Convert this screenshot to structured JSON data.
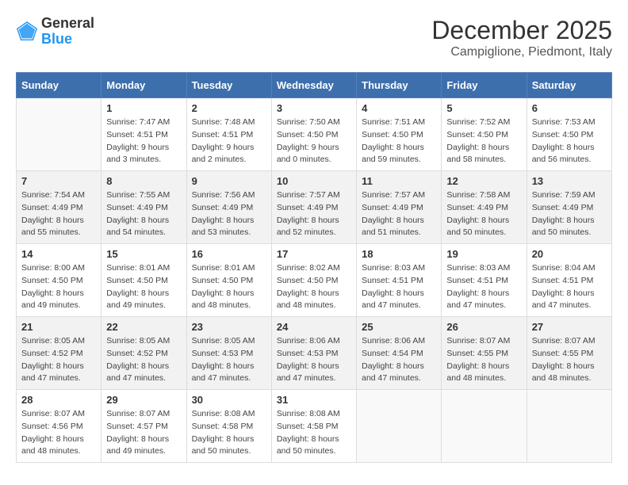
{
  "logo": {
    "general": "General",
    "blue": "Blue"
  },
  "title": "December 2025",
  "subtitle": "Campiglione, Piedmont, Italy",
  "days_of_week": [
    "Sunday",
    "Monday",
    "Tuesday",
    "Wednesday",
    "Thursday",
    "Friday",
    "Saturday"
  ],
  "weeks": [
    {
      "shaded": false,
      "days": [
        {
          "num": "",
          "sunrise": "",
          "sunset": "",
          "daylight": ""
        },
        {
          "num": "1",
          "sunrise": "Sunrise: 7:47 AM",
          "sunset": "Sunset: 4:51 PM",
          "daylight": "Daylight: 9 hours and 3 minutes."
        },
        {
          "num": "2",
          "sunrise": "Sunrise: 7:48 AM",
          "sunset": "Sunset: 4:51 PM",
          "daylight": "Daylight: 9 hours and 2 minutes."
        },
        {
          "num": "3",
          "sunrise": "Sunrise: 7:50 AM",
          "sunset": "Sunset: 4:50 PM",
          "daylight": "Daylight: 9 hours and 0 minutes."
        },
        {
          "num": "4",
          "sunrise": "Sunrise: 7:51 AM",
          "sunset": "Sunset: 4:50 PM",
          "daylight": "Daylight: 8 hours and 59 minutes."
        },
        {
          "num": "5",
          "sunrise": "Sunrise: 7:52 AM",
          "sunset": "Sunset: 4:50 PM",
          "daylight": "Daylight: 8 hours and 58 minutes."
        },
        {
          "num": "6",
          "sunrise": "Sunrise: 7:53 AM",
          "sunset": "Sunset: 4:50 PM",
          "daylight": "Daylight: 8 hours and 56 minutes."
        }
      ]
    },
    {
      "shaded": true,
      "days": [
        {
          "num": "7",
          "sunrise": "Sunrise: 7:54 AM",
          "sunset": "Sunset: 4:49 PM",
          "daylight": "Daylight: 8 hours and 55 minutes."
        },
        {
          "num": "8",
          "sunrise": "Sunrise: 7:55 AM",
          "sunset": "Sunset: 4:49 PM",
          "daylight": "Daylight: 8 hours and 54 minutes."
        },
        {
          "num": "9",
          "sunrise": "Sunrise: 7:56 AM",
          "sunset": "Sunset: 4:49 PM",
          "daylight": "Daylight: 8 hours and 53 minutes."
        },
        {
          "num": "10",
          "sunrise": "Sunrise: 7:57 AM",
          "sunset": "Sunset: 4:49 PM",
          "daylight": "Daylight: 8 hours and 52 minutes."
        },
        {
          "num": "11",
          "sunrise": "Sunrise: 7:57 AM",
          "sunset": "Sunset: 4:49 PM",
          "daylight": "Daylight: 8 hours and 51 minutes."
        },
        {
          "num": "12",
          "sunrise": "Sunrise: 7:58 AM",
          "sunset": "Sunset: 4:49 PM",
          "daylight": "Daylight: 8 hours and 50 minutes."
        },
        {
          "num": "13",
          "sunrise": "Sunrise: 7:59 AM",
          "sunset": "Sunset: 4:49 PM",
          "daylight": "Daylight: 8 hours and 50 minutes."
        }
      ]
    },
    {
      "shaded": false,
      "days": [
        {
          "num": "14",
          "sunrise": "Sunrise: 8:00 AM",
          "sunset": "Sunset: 4:50 PM",
          "daylight": "Daylight: 8 hours and 49 minutes."
        },
        {
          "num": "15",
          "sunrise": "Sunrise: 8:01 AM",
          "sunset": "Sunset: 4:50 PM",
          "daylight": "Daylight: 8 hours and 49 minutes."
        },
        {
          "num": "16",
          "sunrise": "Sunrise: 8:01 AM",
          "sunset": "Sunset: 4:50 PM",
          "daylight": "Daylight: 8 hours and 48 minutes."
        },
        {
          "num": "17",
          "sunrise": "Sunrise: 8:02 AM",
          "sunset": "Sunset: 4:50 PM",
          "daylight": "Daylight: 8 hours and 48 minutes."
        },
        {
          "num": "18",
          "sunrise": "Sunrise: 8:03 AM",
          "sunset": "Sunset: 4:51 PM",
          "daylight": "Daylight: 8 hours and 47 minutes."
        },
        {
          "num": "19",
          "sunrise": "Sunrise: 8:03 AM",
          "sunset": "Sunset: 4:51 PM",
          "daylight": "Daylight: 8 hours and 47 minutes."
        },
        {
          "num": "20",
          "sunrise": "Sunrise: 8:04 AM",
          "sunset": "Sunset: 4:51 PM",
          "daylight": "Daylight: 8 hours and 47 minutes."
        }
      ]
    },
    {
      "shaded": true,
      "days": [
        {
          "num": "21",
          "sunrise": "Sunrise: 8:05 AM",
          "sunset": "Sunset: 4:52 PM",
          "daylight": "Daylight: 8 hours and 47 minutes."
        },
        {
          "num": "22",
          "sunrise": "Sunrise: 8:05 AM",
          "sunset": "Sunset: 4:52 PM",
          "daylight": "Daylight: 8 hours and 47 minutes."
        },
        {
          "num": "23",
          "sunrise": "Sunrise: 8:05 AM",
          "sunset": "Sunset: 4:53 PM",
          "daylight": "Daylight: 8 hours and 47 minutes."
        },
        {
          "num": "24",
          "sunrise": "Sunrise: 8:06 AM",
          "sunset": "Sunset: 4:53 PM",
          "daylight": "Daylight: 8 hours and 47 minutes."
        },
        {
          "num": "25",
          "sunrise": "Sunrise: 8:06 AM",
          "sunset": "Sunset: 4:54 PM",
          "daylight": "Daylight: 8 hours and 47 minutes."
        },
        {
          "num": "26",
          "sunrise": "Sunrise: 8:07 AM",
          "sunset": "Sunset: 4:55 PM",
          "daylight": "Daylight: 8 hours and 48 minutes."
        },
        {
          "num": "27",
          "sunrise": "Sunrise: 8:07 AM",
          "sunset": "Sunset: 4:55 PM",
          "daylight": "Daylight: 8 hours and 48 minutes."
        }
      ]
    },
    {
      "shaded": false,
      "days": [
        {
          "num": "28",
          "sunrise": "Sunrise: 8:07 AM",
          "sunset": "Sunset: 4:56 PM",
          "daylight": "Daylight: 8 hours and 48 minutes."
        },
        {
          "num": "29",
          "sunrise": "Sunrise: 8:07 AM",
          "sunset": "Sunset: 4:57 PM",
          "daylight": "Daylight: 8 hours and 49 minutes."
        },
        {
          "num": "30",
          "sunrise": "Sunrise: 8:08 AM",
          "sunset": "Sunset: 4:58 PM",
          "daylight": "Daylight: 8 hours and 50 minutes."
        },
        {
          "num": "31",
          "sunrise": "Sunrise: 8:08 AM",
          "sunset": "Sunset: 4:58 PM",
          "daylight": "Daylight: 8 hours and 50 minutes."
        },
        {
          "num": "",
          "sunrise": "",
          "sunset": "",
          "daylight": ""
        },
        {
          "num": "",
          "sunrise": "",
          "sunset": "",
          "daylight": ""
        },
        {
          "num": "",
          "sunrise": "",
          "sunset": "",
          "daylight": ""
        }
      ]
    }
  ]
}
